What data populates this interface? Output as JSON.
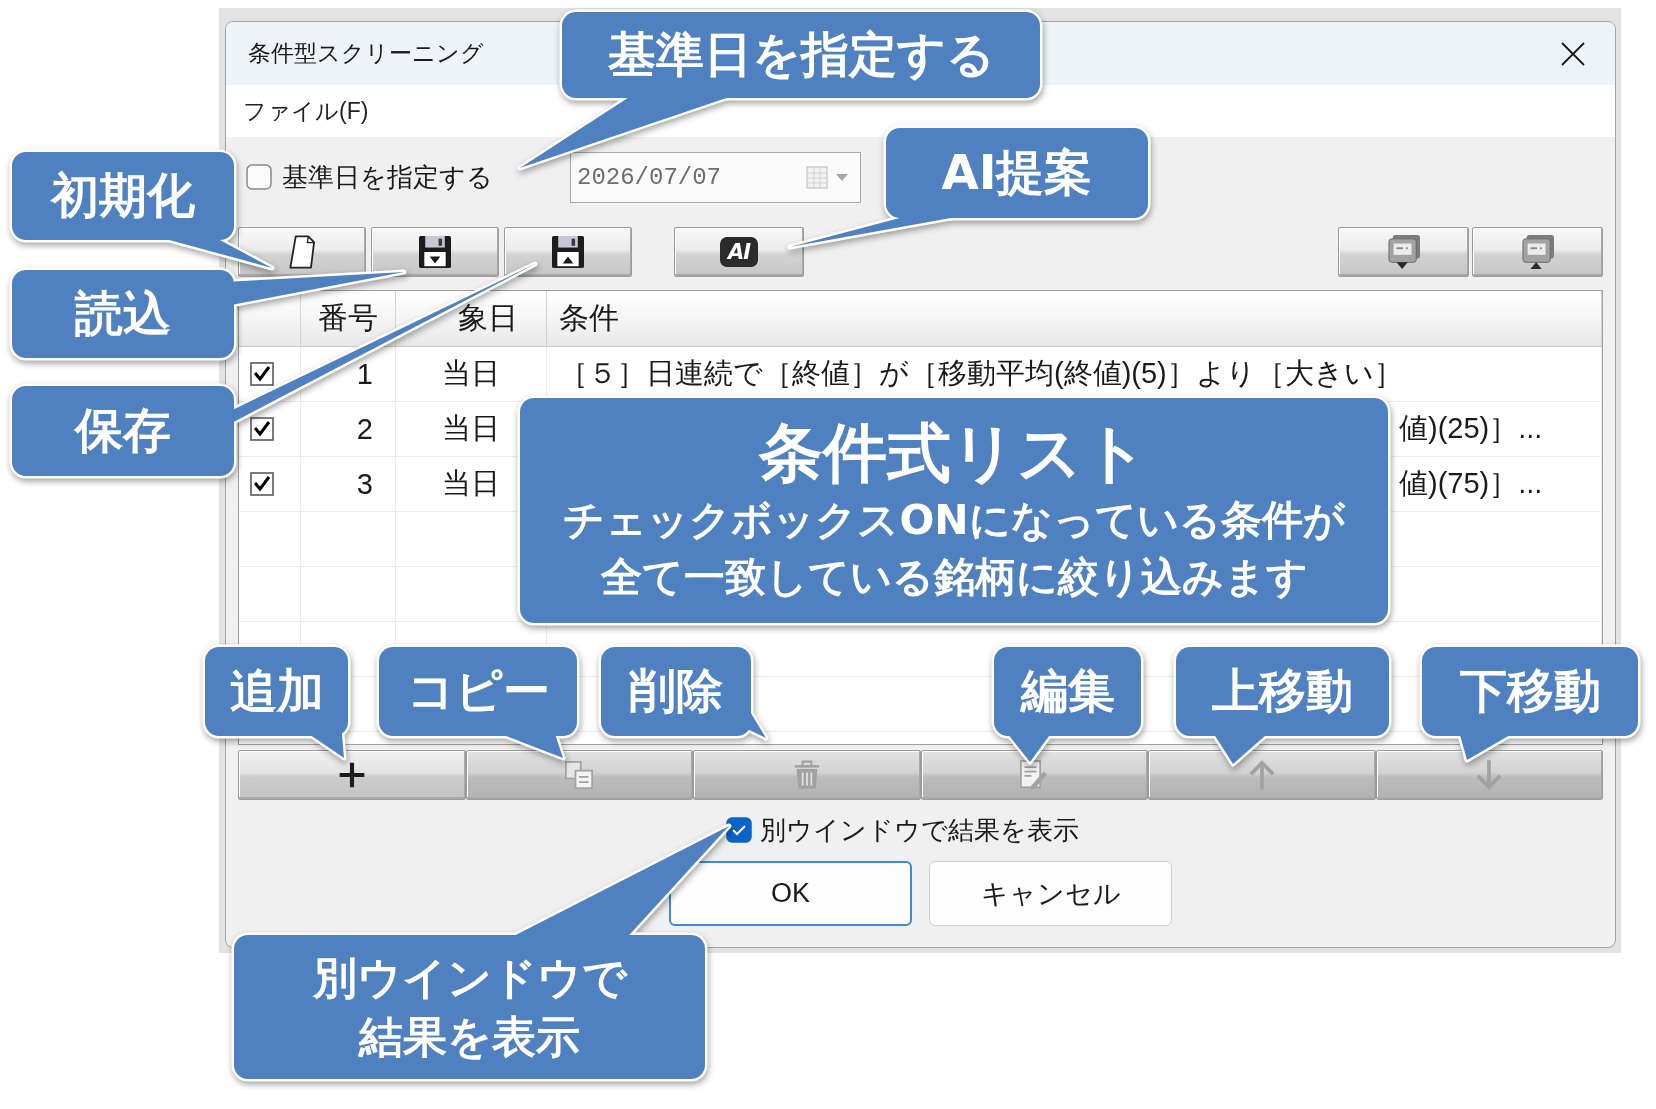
{
  "window": {
    "title": "条件型スクリーニング"
  },
  "menu": [
    {
      "label": "ファイル(F)"
    }
  ],
  "base_date": {
    "label": "基準日を指定する",
    "checked": false,
    "value": "2026/07/07",
    "disabled": true
  },
  "toolbar": {
    "left": [
      {
        "kind": "page"
      },
      {
        "kind": "disk-down"
      },
      {
        "kind": "disk-up"
      }
    ],
    "ai_button": {
      "text": "AI"
    },
    "right": [
      {
        "kind": "monitor-down"
      },
      {
        "kind": "monitor-up"
      }
    ]
  },
  "table": {
    "columns": [
      "番号",
      "象日",
      "条件"
    ],
    "rows": [
      {
        "checked": true,
        "number": "1",
        "target": "当日",
        "condition": "［５］日連続で［終値］が［移動平均(終値)(5)］より［大きい］"
      },
      {
        "checked": true,
        "number": "2",
        "target": "当日",
        "condition": "値)(25)］..."
      },
      {
        "checked": true,
        "number": "3",
        "target": "当日",
        "condition": "値)(75)］..."
      }
    ]
  },
  "row_buttons": [
    {
      "kind": "plus",
      "disabled": false
    },
    {
      "kind": "copy",
      "disabled": true
    },
    {
      "kind": "trash",
      "disabled": true
    },
    {
      "kind": "edit",
      "disabled": true
    },
    {
      "kind": "arrow-up",
      "disabled": true
    },
    {
      "kind": "arrow-down",
      "disabled": true
    }
  ],
  "show_in_window": {
    "label": "別ウインドウで結果を表示",
    "checked": true
  },
  "dialog_buttons": [
    {
      "label": "OK",
      "default": true
    },
    {
      "label": "キャンセル",
      "default": false
    }
  ],
  "callouts": [
    {
      "text": "基準日を指定する"
    },
    {
      "text": "初期化"
    },
    {
      "text": "読込"
    },
    {
      "text": "保存"
    },
    {
      "text": "AI提案"
    },
    {
      "title": "条件式リスト",
      "text": "チェックボックスONになっている条件が全て一致している銘柄に絞り込みます"
    },
    {
      "text": "追加"
    },
    {
      "text": "コピー"
    },
    {
      "text": "削除"
    },
    {
      "text": "編集"
    },
    {
      "text": "上移動"
    },
    {
      "text": "下移動"
    },
    {
      "text": "別ウインドウで結果を表示"
    }
  ]
}
